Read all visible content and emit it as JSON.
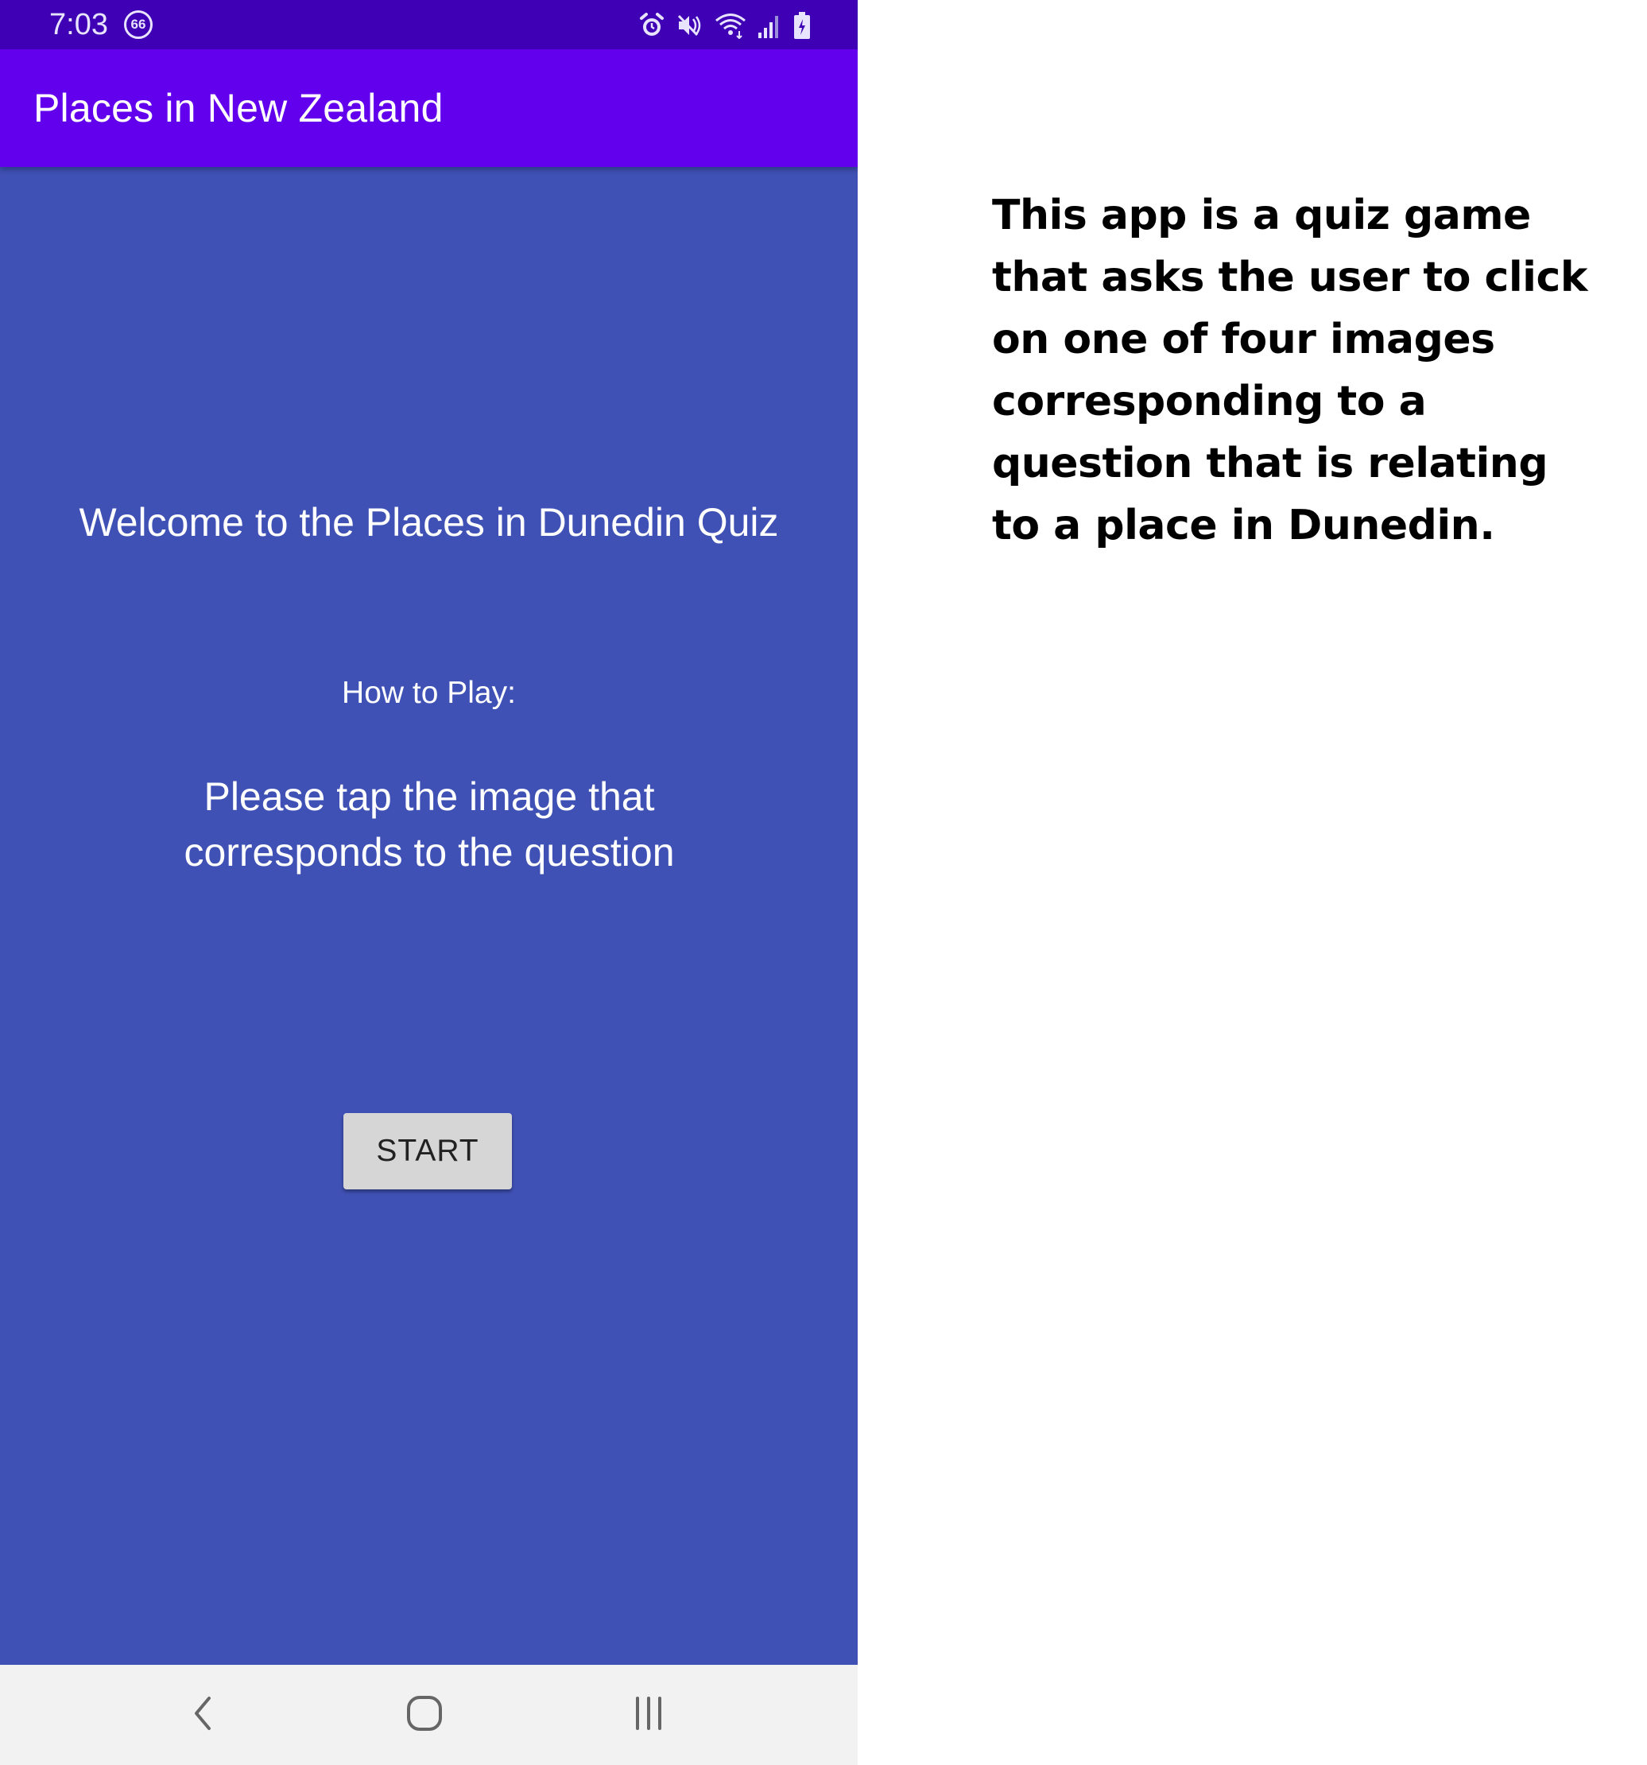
{
  "status_bar": {
    "time": "7:03",
    "notification_badge": "66",
    "icons": [
      "alarm-icon",
      "mute-icon",
      "wifi-icon",
      "signal-icon",
      "battery-icon"
    ],
    "background_color": "#3f00b5"
  },
  "app_bar": {
    "title": "Places in New Zealand",
    "background_color": "#6200ee"
  },
  "main": {
    "background_color": "#3f51b5",
    "welcome_text": "Welcome to the Places in Dunedin Quiz",
    "how_to_play_label": "How to Play:",
    "instructions_text": "Please tap the image that corresponds to the question",
    "start_button_label": "START"
  },
  "nav_bar": {
    "buttons": [
      "back-icon",
      "home-icon",
      "recents-icon"
    ]
  },
  "description": {
    "text": "This app is a quiz game that asks the user to click on one of four images corresponding to a question that is relating to a place in Dunedin."
  }
}
